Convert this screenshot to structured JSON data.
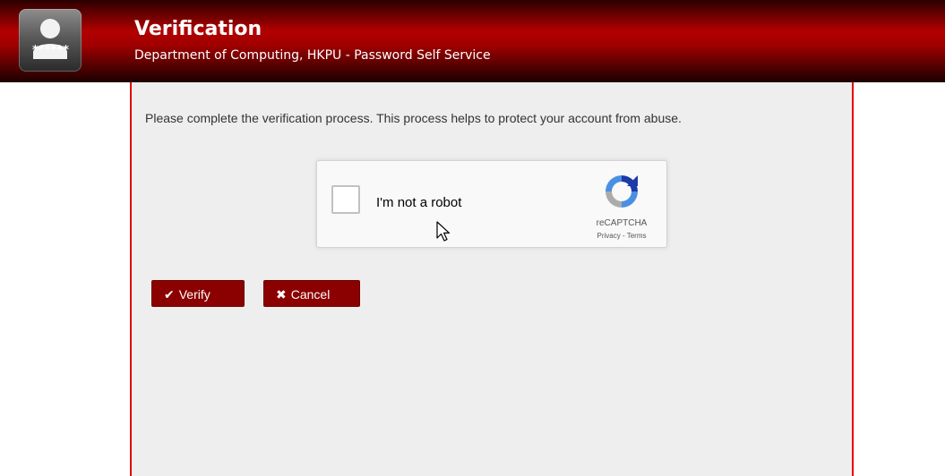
{
  "header": {
    "title": "Verification",
    "subtitle": "Department of Computing, HKPU - Password Self Service",
    "logo_text": "******"
  },
  "main": {
    "message": "Please complete the verification process. This process helps to protect your account from abuse."
  },
  "captcha": {
    "checkbox_label": "I'm not a robot",
    "brand": "reCAPTCHA",
    "privacy_link": "Privacy",
    "separator": " - ",
    "terms_link": "Terms",
    "checked": false
  },
  "buttons": {
    "verify_icon": "✔",
    "verify_label": "Verify",
    "cancel_icon": "✖",
    "cancel_label": "Cancel"
  },
  "icons": {
    "logo": "user-password-icon",
    "recaptcha": "recaptcha-logo-icon",
    "verify": "check-icon",
    "cancel": "times-icon",
    "cursor": "mouse-pointer-icon"
  },
  "colors": {
    "header_red": "#b30000",
    "panel_border": "#e60000",
    "panel_bg": "#eeeeee",
    "button_bg": "#8b0000"
  }
}
